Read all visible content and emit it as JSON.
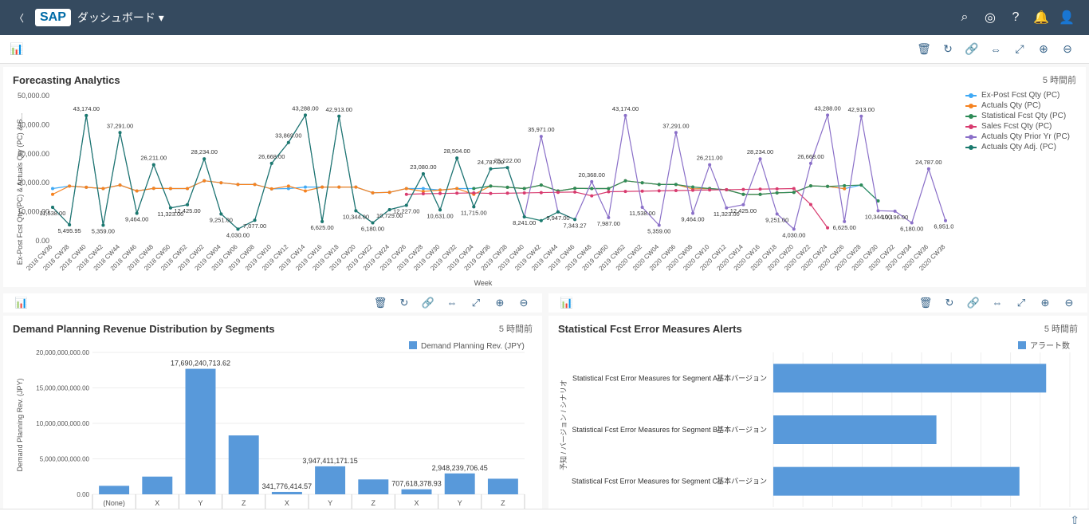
{
  "header": {
    "title": "ダッシュボード ▾"
  },
  "toolbar_icons": [
    "🗑",
    "↻",
    "🔗",
    "⇔",
    "⤢",
    "⊕",
    "⊖"
  ],
  "panel1": {
    "title": "Forecasting Analytics",
    "time": "5 時間前",
    "xlabel": "Week",
    "ylabel": "Ex-Post Fcst Qty (PC) & Actuals Qty (PC) & S...",
    "legend": [
      {
        "name": "Ex-Post Fcst Qty (PC)",
        "color": "#3fa9f5"
      },
      {
        "name": "Actuals Qty (PC)",
        "color": "#f58220"
      },
      {
        "name": "Statistical Fcst Qty (PC)",
        "color": "#2e8b57"
      },
      {
        "name": "Sales Fcst Qty (PC)",
        "color": "#d83b6f"
      },
      {
        "name": "Actuals Qty Prior Yr (PC)",
        "color": "#8a6fc8"
      },
      {
        "name": "Actuals Qty Adj. (PC)",
        "color": "#1a7a6e"
      }
    ]
  },
  "panel2": {
    "title": "Demand Planning Revenue Distribution by Segments",
    "time": "5 時間前",
    "legend_label": "Demand Planning Rev. (JPY)",
    "ylabel": "Demand Planning Rev. (JPY)"
  },
  "panel3": {
    "title": "Statistical Fcst Error Measures Alerts",
    "time": "5 時間前",
    "legend_label": "アラート数",
    "ylabel": "予知 / バージョン / シナリオ"
  },
  "chart_data": [
    {
      "type": "line",
      "id": "forecasting",
      "ylim": [
        0,
        50000
      ],
      "yticks": [
        0,
        10000,
        20000,
        30000,
        40000,
        50000
      ],
      "ytick_labels": [
        "0.00",
        "10,000.00",
        "20,000.00",
        "30,000.00",
        "40,000.00",
        "50,000.00"
      ],
      "categories": [
        "2018 CW36",
        "2018 CW38",
        "2018 CW40",
        "2018 CW42",
        "2018 CW44",
        "2018 CW46",
        "2018 CW48",
        "2018 CW50",
        "2018 CW52",
        "2019 CW02",
        "2019 CW04",
        "2019 CW06",
        "2019 CW08",
        "2019 CW10",
        "2019 CW12",
        "2019 CW14",
        "2019 CW16",
        "2019 CW18",
        "2019 CW20",
        "2019 CW22",
        "2019 CW24",
        "2019 CW26",
        "2019 CW28",
        "2019 CW30",
        "2019 CW32",
        "2019 CW34",
        "2019 CW36",
        "2019 CW38",
        "2019 CW40",
        "2019 CW42",
        "2019 CW44",
        "2019 CW46",
        "2019 CW48",
        "2019 CW50",
        "2019 CW52",
        "2020 CW02",
        "2020 CW04",
        "2020 CW06",
        "2020 CW08",
        "2020 CW10",
        "2020 CW12",
        "2020 CW14",
        "2020 CW16",
        "2020 CW18",
        "2020 CW20",
        "2020 CW22",
        "2020 CW24",
        "2020 CW26",
        "2020 CW28",
        "2020 CW30",
        "2020 CW32",
        "2020 CW34",
        "2020 CW36",
        "2020 CW38"
      ],
      "series": [
        {
          "name": "Ex-Post Fcst Qty (PC)",
          "color": "#3fa9f5",
          "values": [
            18000,
            18856,
            18434,
            18000,
            19191,
            17183,
            18054,
            18000,
            18000,
            20683,
            20000,
            19404,
            19414,
            17881,
            18000,
            18500,
            18500,
            18500,
            18500,
            16529,
            16691,
            18000,
            18000,
            17488,
            18000,
            18000,
            18856,
            18434,
            18000,
            19191,
            17183,
            18054,
            18000,
            18000,
            20683,
            20000,
            19404,
            19414,
            17881,
            18000,
            17578,
            16000,
            16000,
            16529,
            16691,
            18930,
            18737,
            17950,
            19213,
            13723,
            null,
            null,
            null,
            null
          ]
        },
        {
          "name": "Actuals Qty (PC)",
          "color": "#f58220",
          "values": [
            16000,
            18856,
            18434,
            18000,
            19191,
            17183,
            18054,
            18000,
            18000,
            20683,
            20000,
            19404,
            19414,
            17881,
            18855,
            17181,
            18500,
            18500,
            18500,
            16529,
            16691,
            18000,
            17000,
            17488,
            18000,
            16000,
            18856,
            18434,
            18000,
            19191,
            17183,
            18054,
            18000,
            18000,
            20683,
            20000,
            19404,
            19414,
            17881,
            18000,
            17578,
            16000,
            16000,
            16529,
            16691,
            18930,
            18737,
            17950,
            null,
            null,
            null,
            null,
            null,
            null
          ]
        },
        {
          "name": "Statistical Fcst Qty (PC)",
          "color": "#2e8b57",
          "values": [
            null,
            null,
            null,
            null,
            null,
            null,
            null,
            null,
            null,
            null,
            null,
            null,
            null,
            null,
            null,
            null,
            null,
            null,
            null,
            null,
            null,
            null,
            null,
            null,
            null,
            18000,
            18856,
            18434,
            18000,
            19191,
            17183,
            18054,
            18000,
            18000,
            20683,
            20000,
            19404,
            19414,
            18551,
            18000,
            17578,
            16000,
            16000,
            16529,
            16691,
            18930,
            18737,
            19000,
            19213,
            13723,
            null,
            null,
            null,
            null
          ]
        },
        {
          "name": "Sales Fcst Qty (PC)",
          "color": "#d83b6f",
          "values": [
            null,
            null,
            null,
            null,
            null,
            null,
            null,
            null,
            null,
            null,
            null,
            null,
            null,
            null,
            null,
            null,
            null,
            null,
            null,
            null,
            null,
            16000,
            16200,
            16300,
            16400,
            16500,
            16325,
            16400,
            16500,
            16600,
            16700,
            16800,
            15501,
            16900,
            17000,
            17100,
            17200,
            17300,
            17400,
            17500,
            17600,
            17700,
            17800,
            17900,
            18000,
            12500,
            4469,
            null,
            null,
            null,
            null,
            null,
            null,
            null
          ]
        },
        {
          "name": "Actuals Qty Prior Yr (PC)",
          "color": "#8a6fc8",
          "values": [
            11538,
            5495,
            43174,
            5359,
            37291,
            9464,
            26211,
            11323,
            12425,
            28234,
            9251,
            4030,
            7077,
            26668,
            33869,
            43288,
            6625,
            42913,
            10344,
            6180,
            10729,
            12227,
            23080,
            10631,
            28504,
            11715,
            24787,
            25222,
            8241,
            35971,
            9947,
            7343,
            20368,
            7987,
            43174,
            11538,
            5359,
            37291,
            9464,
            26211,
            11323,
            12425,
            28234,
            9251,
            4030,
            26668,
            43288,
            6625,
            42913,
            10344,
            10196,
            6180,
            24787,
            6951
          ]
        },
        {
          "name": "Actuals Qty Adj. (PC)",
          "color": "#1a7a6e",
          "values": [
            11538,
            5495,
            43174,
            5359,
            37291,
            9464,
            26211,
            11323,
            12425,
            28234,
            9251,
            4030,
            7077,
            26668,
            33869,
            43288,
            6625,
            42913,
            10344,
            6180,
            10729,
            12227,
            23080,
            10631,
            28504,
            11715,
            24787,
            25222,
            8241,
            6951,
            9947,
            7343,
            null,
            null,
            null,
            null,
            null,
            null,
            null,
            null,
            null,
            null,
            null,
            null,
            null,
            null,
            null,
            null,
            null,
            null,
            null,
            null,
            null,
            null
          ]
        }
      ],
      "data_labels": [
        {
          "x": 2,
          "v": "43,174.00"
        },
        {
          "x": 4,
          "v": "37,291.00"
        },
        {
          "x": 6,
          "v": "26,211.00"
        },
        {
          "x": 9,
          "v": "28,234.00"
        },
        {
          "x": 13,
          "v": "26,668.00"
        },
        {
          "x": 14,
          "v": "33,869.00"
        },
        {
          "x": 15,
          "v": "43,288.00"
        },
        {
          "x": 17,
          "v": "42,913.00"
        },
        {
          "x": 22,
          "v": "23,080.00"
        },
        {
          "x": 24,
          "v": "28,504.00"
        },
        {
          "x": 26,
          "v": "24,787.00"
        },
        {
          "x": 27,
          "v": "25,222.00"
        },
        {
          "x": 29,
          "v": "35,971.00"
        },
        {
          "x": 32,
          "v": "20,368.00"
        },
        {
          "x": 34,
          "v": "43,174.00"
        },
        {
          "x": 37,
          "v": "37,291.00"
        },
        {
          "x": 39,
          "v": "26,211.00"
        },
        {
          "x": 42,
          "v": "28,234.00"
        },
        {
          "x": 45,
          "v": "26,668.00"
        },
        {
          "x": 46,
          "v": "43,288.00"
        },
        {
          "x": 48,
          "v": "42,913.00"
        },
        {
          "x": 52,
          "v": "24,787.00"
        },
        {
          "x": 0,
          "v": "11,538.00",
          "below": true
        },
        {
          "x": 1,
          "v": "5,495.95",
          "below": true
        },
        {
          "x": 3,
          "v": "5,359.00",
          "below": true
        },
        {
          "x": 5,
          "v": "9,464.00",
          "below": true
        },
        {
          "x": 7,
          "v": "11,323.00",
          "below": true
        },
        {
          "x": 8,
          "v": "12,425.00",
          "below": true
        },
        {
          "x": 10,
          "v": "9,251.00",
          "below": true
        },
        {
          "x": 11,
          "v": "4,030.00",
          "below": true
        },
        {
          "x": 12,
          "v": "7,077.00",
          "below": true
        },
        {
          "x": 16,
          "v": "6,625.00",
          "below": true
        },
        {
          "x": 18,
          "v": "10,344.00",
          "below": true
        },
        {
          "x": 19,
          "v": "6,180.00",
          "below": true
        },
        {
          "x": 20,
          "v": "10,729.00",
          "below": true
        },
        {
          "x": 21,
          "v": "12,227.00",
          "below": true
        },
        {
          "x": 23,
          "v": "10,631.00",
          "below": true
        },
        {
          "x": 25,
          "v": "11,715.00",
          "below": true
        },
        {
          "x": 28,
          "v": "8,241.00",
          "below": true
        },
        {
          "x": 30,
          "v": "9,947.00",
          "below": true
        },
        {
          "x": 31,
          "v": "7,343.27",
          "below": true
        },
        {
          "x": 33,
          "v": "7,987.00",
          "below": true
        },
        {
          "x": 35,
          "v": "11,538.00",
          "below": true
        },
        {
          "x": 36,
          "v": "5,359.00",
          "below": true
        },
        {
          "x": 38,
          "v": "9,464.00",
          "below": true
        },
        {
          "x": 40,
          "v": "11,323.00",
          "below": true
        },
        {
          "x": 41,
          "v": "12,425.00",
          "below": true
        },
        {
          "x": 43,
          "v": "9,251.00",
          "below": true
        },
        {
          "x": 44,
          "v": "4,030.00",
          "below": true
        },
        {
          "x": 47,
          "v": "6,625.00",
          "below": true
        },
        {
          "x": 49,
          "v": "10,344.00",
          "below": true
        },
        {
          "x": 50,
          "v": "10,196.00",
          "below": true
        },
        {
          "x": 51,
          "v": "6,180.00",
          "below": true
        },
        {
          "x": 53,
          "v": "6,951.00",
          "below": true
        }
      ]
    },
    {
      "type": "bar",
      "id": "revenue",
      "ylim": [
        0,
        20000000000
      ],
      "yticks": [
        0,
        5000000000,
        10000000000,
        15000000000,
        20000000000
      ],
      "ytick_labels": [
        "0.00",
        "5,000,000,000.00",
        "10,000,000,000.00",
        "15,000,000,000.00",
        "20,000,000,000.00"
      ],
      "categories": [
        "(None)",
        "X",
        "Y",
        "Z",
        "X",
        "Y",
        "Z",
        "X",
        "Y",
        "Z"
      ],
      "values": [
        1200000000,
        2500000000,
        17690240713.62,
        8300000000,
        341776414.57,
        3947411171.15,
        2100000000,
        707618378.93,
        2948239706.45,
        2200000000
      ],
      "value_labels": [
        "",
        "",
        "17,690,240,713.62",
        "",
        "341,776,414.57",
        "3,947,411,171.15",
        "",
        "707,618,378.93",
        "2,948,239,706.45",
        ""
      ]
    },
    {
      "type": "bar-h",
      "id": "alerts",
      "xlim": [
        0,
        10
      ],
      "categories": [
        {
          "main": "Statistical Fcst Error Measures for Segment A",
          "sub": "基本バージョン"
        },
        {
          "main": "Statistical Fcst Error Measures for Segment B",
          "sub": "基本バージョン"
        },
        {
          "main": "Statistical Fcst Error Measures for Segment C",
          "sub": "基本バージョン"
        }
      ],
      "values": [
        9.2,
        5.5,
        8.3
      ]
    }
  ]
}
